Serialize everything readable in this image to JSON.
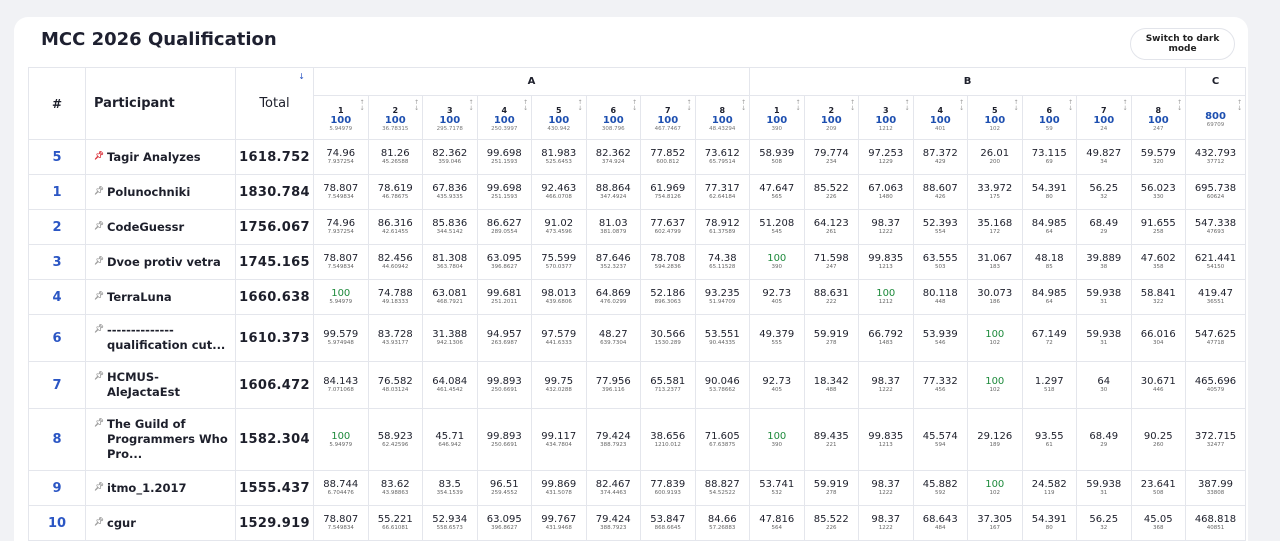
{
  "page": {
    "title": "MCC 2026 Qualification",
    "dark_mode_button": "Switch to dark mode"
  },
  "table": {
    "headers": {
      "rank": "#",
      "participant": "Participant",
      "total": "Total"
    },
    "groups": [
      {
        "label": "A",
        "span": 8
      },
      {
        "label": "B",
        "span": 8
      },
      {
        "label": "C",
        "span": 1
      }
    ],
    "problems": [
      {
        "idx": "1",
        "max": "100",
        "pen": "5.94979"
      },
      {
        "idx": "2",
        "max": "100",
        "pen": "36.78315"
      },
      {
        "idx": "3",
        "max": "100",
        "pen": "295.7178"
      },
      {
        "idx": "4",
        "max": "100",
        "pen": "250.3997"
      },
      {
        "idx": "5",
        "max": "100",
        "pen": "430.942"
      },
      {
        "idx": "6",
        "max": "100",
        "pen": "308.796"
      },
      {
        "idx": "7",
        "max": "100",
        "pen": "467.7467"
      },
      {
        "idx": "8",
        "max": "100",
        "pen": "48.43294"
      },
      {
        "idx": "1",
        "max": "100",
        "pen": "390"
      },
      {
        "idx": "2",
        "max": "100",
        "pen": "209"
      },
      {
        "idx": "3",
        "max": "100",
        "pen": "1212"
      },
      {
        "idx": "4",
        "max": "100",
        "pen": "401"
      },
      {
        "idx": "5",
        "max": "100",
        "pen": "102"
      },
      {
        "idx": "6",
        "max": "100",
        "pen": "59"
      },
      {
        "idx": "7",
        "max": "100",
        "pen": "24"
      },
      {
        "idx": "8",
        "max": "100",
        "pen": "247"
      },
      {
        "idx": "",
        "max": "800",
        "pen": "69709"
      }
    ],
    "rows": [
      {
        "rank": "5",
        "name": "Tagir Analyzes",
        "pinned": true,
        "total": "1618.752",
        "cells": [
          [
            "74.96",
            "7.937254"
          ],
          [
            "81.26",
            "45.26588"
          ],
          [
            "82.362",
            "359.046"
          ],
          [
            "99.698",
            "251.1593"
          ],
          [
            "81.983",
            "525.6453"
          ],
          [
            "82.362",
            "374.924"
          ],
          [
            "77.852",
            "600.812"
          ],
          [
            "73.612",
            "65.79514"
          ],
          [
            "58.939",
            "508"
          ],
          [
            "79.774",
            "234"
          ],
          [
            "97.253",
            "1229"
          ],
          [
            "87.372",
            "429"
          ],
          [
            "26.01",
            "200"
          ],
          [
            "73.115",
            "69"
          ],
          [
            "49.827",
            "34"
          ],
          [
            "59.579",
            "320"
          ],
          [
            "432.793",
            "37712"
          ]
        ]
      },
      {
        "rank": "1",
        "name": "Polunochniki",
        "pinned": false,
        "total": "1830.784",
        "cells": [
          [
            "78.807",
            "7.549834"
          ],
          [
            "78.619",
            "46.78675"
          ],
          [
            "67.836",
            "435.9335"
          ],
          [
            "99.698",
            "251.1593"
          ],
          [
            "92.463",
            "466.0708"
          ],
          [
            "88.864",
            "347.4924"
          ],
          [
            "61.969",
            "754.8126"
          ],
          [
            "77.317",
            "62.64184"
          ],
          [
            "47.647",
            "565"
          ],
          [
            "85.522",
            "226"
          ],
          [
            "67.063",
            "1480"
          ],
          [
            "88.607",
            "426"
          ],
          [
            "33.972",
            "175"
          ],
          [
            "54.391",
            "80"
          ],
          [
            "56.25",
            "32"
          ],
          [
            "56.023",
            "330"
          ],
          [
            "695.738",
            "60624"
          ]
        ]
      },
      {
        "rank": "2",
        "name": "CodeGuessr",
        "pinned": false,
        "total": "1756.067",
        "cells": [
          [
            "74.96",
            "7.937254"
          ],
          [
            "86.316",
            "42.61455"
          ],
          [
            "85.836",
            "344.5142"
          ],
          [
            "86.627",
            "289.0554"
          ],
          [
            "91.02",
            "473.4596"
          ],
          [
            "81.03",
            "381.0879"
          ],
          [
            "77.637",
            "602.4799"
          ],
          [
            "78.912",
            "61.37589"
          ],
          [
            "51.208",
            "545"
          ],
          [
            "64.123",
            "261"
          ],
          [
            "98.37",
            "1222"
          ],
          [
            "52.393",
            "554"
          ],
          [
            "35.168",
            "172"
          ],
          [
            "84.985",
            "64"
          ],
          [
            "68.49",
            "29"
          ],
          [
            "91.655",
            "258"
          ],
          [
            "547.338",
            "47693"
          ]
        ]
      },
      {
        "rank": "3",
        "name": "Dvoe protiv vetra",
        "pinned": false,
        "total": "1745.165",
        "cells": [
          [
            "78.807",
            "7.549834"
          ],
          [
            "82.456",
            "44.60942"
          ],
          [
            "81.308",
            "363.7804"
          ],
          [
            "63.095",
            "396.8627"
          ],
          [
            "75.599",
            "570.0377"
          ],
          [
            "87.646",
            "352.3237"
          ],
          [
            "78.708",
            "594.2836"
          ],
          [
            "74.38",
            "65.11528"
          ],
          [
            "100",
            "390"
          ],
          [
            "71.598",
            "247"
          ],
          [
            "99.835",
            "1213"
          ],
          [
            "63.555",
            "503"
          ],
          [
            "31.067",
            "183"
          ],
          [
            "48.18",
            "85"
          ],
          [
            "39.889",
            "38"
          ],
          [
            "47.602",
            "358"
          ],
          [
            "621.441",
            "54150"
          ]
        ]
      },
      {
        "rank": "4",
        "name": "TerraLuna",
        "pinned": false,
        "total": "1660.638",
        "cells": [
          [
            "100",
            "5.94979"
          ],
          [
            "74.788",
            "49.18333"
          ],
          [
            "63.081",
            "468.7921"
          ],
          [
            "99.681",
            "251.2011"
          ],
          [
            "98.013",
            "439.6806"
          ],
          [
            "64.869",
            "476.0299"
          ],
          [
            "52.186",
            "896.3063"
          ],
          [
            "93.235",
            "51.94709"
          ],
          [
            "92.73",
            "405"
          ],
          [
            "88.631",
            "222"
          ],
          [
            "100",
            "1212"
          ],
          [
            "80.118",
            "448"
          ],
          [
            "30.073",
            "186"
          ],
          [
            "84.985",
            "64"
          ],
          [
            "59.938",
            "31"
          ],
          [
            "58.841",
            "322"
          ],
          [
            "419.47",
            "36551"
          ]
        ]
      },
      {
        "rank": "6",
        "name": "-------------- qualification cut...",
        "pinned": false,
        "total": "1610.373",
        "cells": [
          [
            "99.579",
            "5.974948"
          ],
          [
            "83.728",
            "43.93177"
          ],
          [
            "31.388",
            "942.1306"
          ],
          [
            "94.957",
            "263.6987"
          ],
          [
            "97.579",
            "441.6333"
          ],
          [
            "48.27",
            "639.7304"
          ],
          [
            "30.566",
            "1530.289"
          ],
          [
            "53.551",
            "90.44335"
          ],
          [
            "49.379",
            "555"
          ],
          [
            "59.919",
            "278"
          ],
          [
            "66.792",
            "1483"
          ],
          [
            "53.939",
            "546"
          ],
          [
            "100",
            "102"
          ],
          [
            "67.149",
            "72"
          ],
          [
            "59.938",
            "31"
          ],
          [
            "66.016",
            "304"
          ],
          [
            "547.625",
            "47718"
          ]
        ]
      },
      {
        "rank": "7",
        "name": "HCMUS-AleJactaEst",
        "pinned": false,
        "total": "1606.472",
        "cells": [
          [
            "84.143",
            "7.071068"
          ],
          [
            "76.582",
            "48.03124"
          ],
          [
            "64.084",
            "461.4542"
          ],
          [
            "99.893",
            "250.6691"
          ],
          [
            "99.75",
            "432.0288"
          ],
          [
            "77.956",
            "396.116"
          ],
          [
            "65.581",
            "713.2377"
          ],
          [
            "90.046",
            "53.78662"
          ],
          [
            "92.73",
            "405"
          ],
          [
            "18.342",
            "488"
          ],
          [
            "98.37",
            "1222"
          ],
          [
            "77.332",
            "456"
          ],
          [
            "100",
            "102"
          ],
          [
            "1.297",
            "518"
          ],
          [
            "64",
            "30"
          ],
          [
            "30.671",
            "446"
          ],
          [
            "465.696",
            "40579"
          ]
        ]
      },
      {
        "rank": "8",
        "name": "The Guild of Programmers Who Pro...",
        "pinned": false,
        "total": "1582.304",
        "cells": [
          [
            "100",
            "5.94979"
          ],
          [
            "58.923",
            "62.42596"
          ],
          [
            "45.71",
            "646.942"
          ],
          [
            "99.893",
            "250.6691"
          ],
          [
            "99.117",
            "434.7804"
          ],
          [
            "79.424",
            "388.7923"
          ],
          [
            "38.656",
            "1210.012"
          ],
          [
            "71.605",
            "67.63875"
          ],
          [
            "100",
            "390"
          ],
          [
            "89.435",
            "221"
          ],
          [
            "99.835",
            "1213"
          ],
          [
            "45.574",
            "594"
          ],
          [
            "29.126",
            "189"
          ],
          [
            "93.55",
            "61"
          ],
          [
            "68.49",
            "29"
          ],
          [
            "90.25",
            "260"
          ],
          [
            "372.715",
            "32477"
          ]
        ]
      },
      {
        "rank": "9",
        "name": "itmo_1.2017",
        "pinned": false,
        "total": "1555.437",
        "cells": [
          [
            "88.744",
            "6.704476"
          ],
          [
            "83.62",
            "43.98863"
          ],
          [
            "83.5",
            "354.1539"
          ],
          [
            "96.51",
            "259.4552"
          ],
          [
            "99.869",
            "431.5078"
          ],
          [
            "82.467",
            "374.4463"
          ],
          [
            "77.839",
            "600.9193"
          ],
          [
            "88.827",
            "54.52522"
          ],
          [
            "53.741",
            "532"
          ],
          [
            "59.919",
            "278"
          ],
          [
            "98.37",
            "1222"
          ],
          [
            "45.882",
            "592"
          ],
          [
            "100",
            "102"
          ],
          [
            "24.582",
            "119"
          ],
          [
            "59.938",
            "31"
          ],
          [
            "23.641",
            "508"
          ],
          [
            "387.99",
            "33808"
          ]
        ]
      },
      {
        "rank": "10",
        "name": "cgur",
        "pinned": false,
        "total": "1529.919",
        "cells": [
          [
            "78.807",
            "7.549834"
          ],
          [
            "55.221",
            "66.61081"
          ],
          [
            "52.934",
            "558.6573"
          ],
          [
            "63.095",
            "396.8627"
          ],
          [
            "99.767",
            "431.9468"
          ],
          [
            "79.424",
            "388.7923"
          ],
          [
            "53.847",
            "868.6645"
          ],
          [
            "84.66",
            "57.26883"
          ],
          [
            "47.816",
            "564"
          ],
          [
            "85.522",
            "226"
          ],
          [
            "98.37",
            "1222"
          ],
          [
            "68.643",
            "484"
          ],
          [
            "37.305",
            "167"
          ],
          [
            "54.391",
            "80"
          ],
          [
            "56.25",
            "32"
          ],
          [
            "45.05",
            "368"
          ],
          [
            "468.818",
            "40851"
          ]
        ]
      }
    ]
  }
}
